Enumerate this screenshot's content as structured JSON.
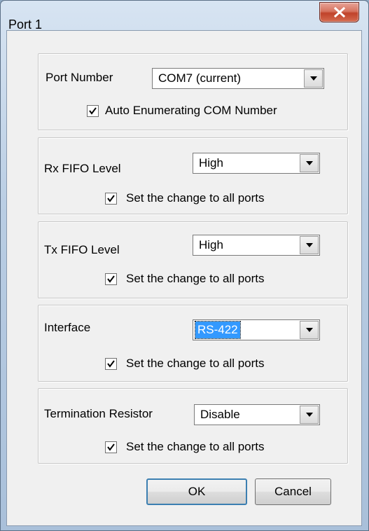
{
  "window": {
    "title": "Port 1"
  },
  "port": {
    "label": "Port Number",
    "value": "COM7 (current)",
    "checkbox_label": "Auto Enumerating COM Number",
    "checked": true
  },
  "rx": {
    "label": "Rx FIFO Level",
    "value": "High",
    "checkbox_label": "Set the change to all ports",
    "checked": true
  },
  "tx": {
    "label": "Tx FIFO Level",
    "value": "High",
    "checkbox_label": "Set the change to all ports",
    "checked": true
  },
  "interface": {
    "label": "Interface",
    "value": "RS-422",
    "checkbox_label": "Set the change to all ports",
    "checked": true
  },
  "termination": {
    "label": "Termination Resistor",
    "value": "Disable",
    "checkbox_label": "Set the change to all ports",
    "checked": true
  },
  "buttons": {
    "ok": "OK",
    "cancel": "Cancel"
  },
  "colors": {
    "selection": "#3399ff",
    "close_button": "#c0432a"
  },
  "icons": {
    "close": "close-x-icon",
    "dropdown": "chevron-down-icon",
    "check": "checkmark-icon"
  }
}
